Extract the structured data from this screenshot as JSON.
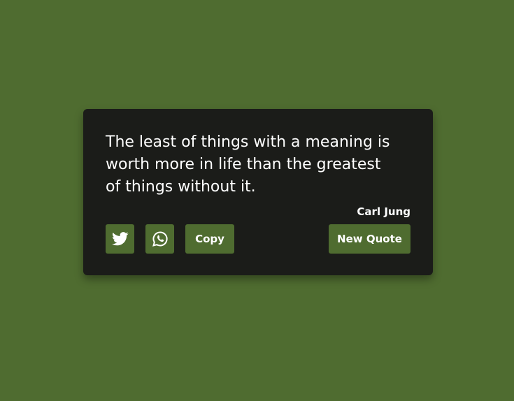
{
  "quote": {
    "text": "The least of things with a meaning is worth more in life than the greatest of things without it.",
    "author": "Carl Jung"
  },
  "actions": {
    "twitter_icon": "twitter-icon",
    "whatsapp_icon": "whatsapp-icon",
    "copy_label": "Copy",
    "new_quote_label": "New Quote"
  },
  "colors": {
    "background": "#4f6c30",
    "card": "#1b1c19",
    "button": "#4f6c30",
    "text": "#ffffff"
  }
}
